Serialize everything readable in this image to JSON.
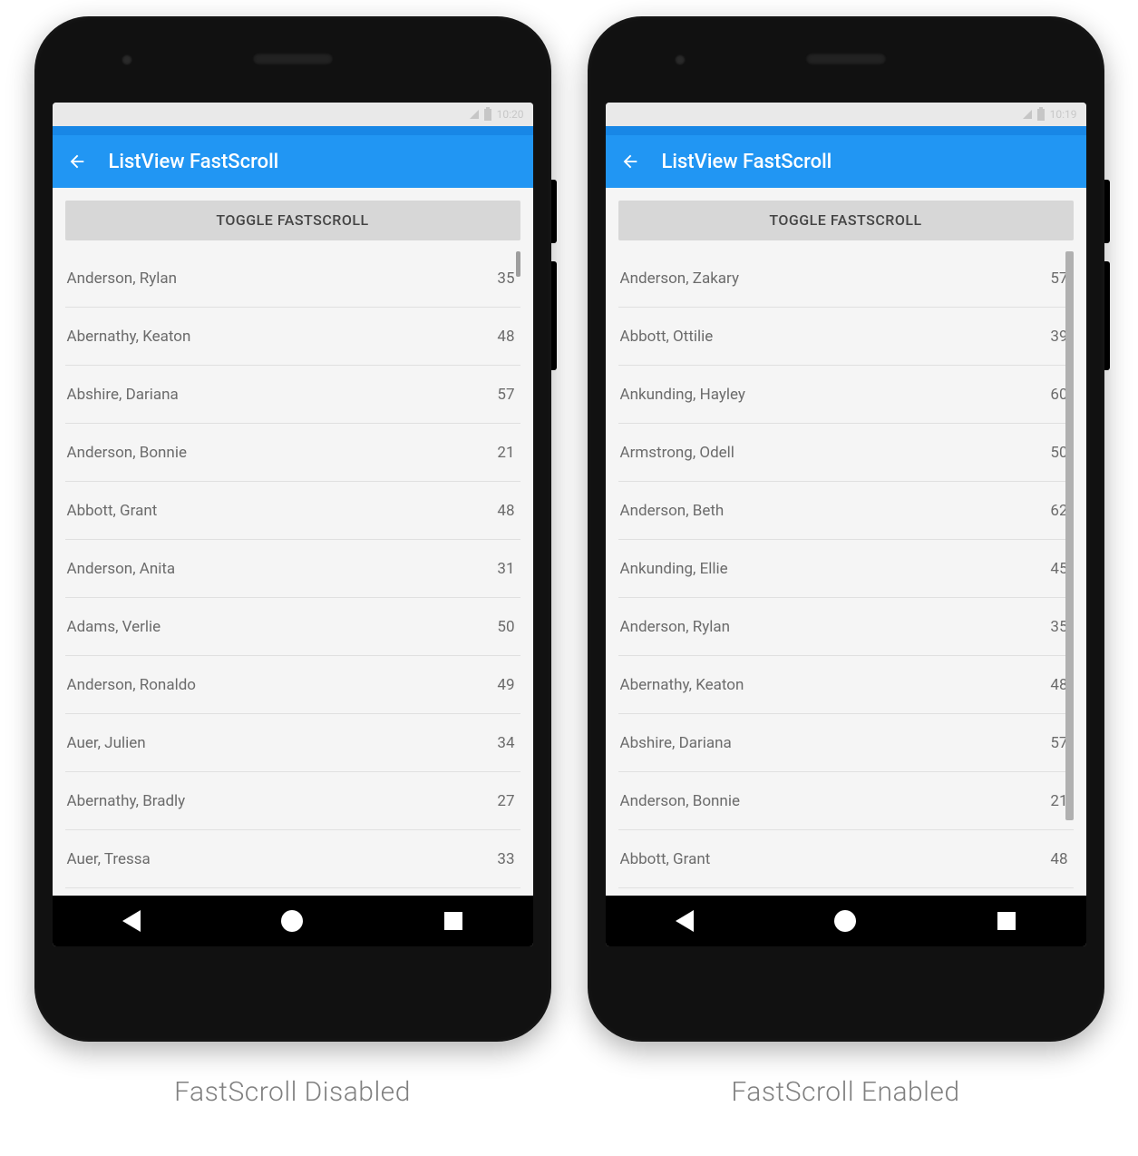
{
  "colors": {
    "primary": "#2196f3",
    "primary_dark": "#1887e6"
  },
  "statusbar": {
    "time_left": "10:20",
    "time_right": "10:19"
  },
  "appbar": {
    "title": "ListView FastScroll"
  },
  "toggle_label": "TOGGLE FASTSCROLL",
  "left": {
    "caption": "FastScroll Disabled",
    "rows": [
      {
        "name": "Anderson, Rylan",
        "value": "35"
      },
      {
        "name": "Abernathy, Keaton",
        "value": "48"
      },
      {
        "name": "Abshire, Dariana",
        "value": "57"
      },
      {
        "name": "Anderson, Bonnie",
        "value": "21"
      },
      {
        "name": "Abbott, Grant",
        "value": "48"
      },
      {
        "name": "Anderson, Anita",
        "value": "31"
      },
      {
        "name": "Adams, Verlie",
        "value": "50"
      },
      {
        "name": "Anderson, Ronaldo",
        "value": "49"
      },
      {
        "name": "Auer, Julien",
        "value": "34"
      },
      {
        "name": "Abernathy, Bradly",
        "value": "27"
      },
      {
        "name": "Auer, Tressa",
        "value": "33"
      }
    ]
  },
  "right": {
    "caption": "FastScroll Enabled",
    "rows": [
      {
        "name": "Anderson, Zakary",
        "value": "57"
      },
      {
        "name": "Abbott, Ottilie",
        "value": "39"
      },
      {
        "name": "Ankunding, Hayley",
        "value": "60"
      },
      {
        "name": "Armstrong, Odell",
        "value": "50"
      },
      {
        "name": "Anderson, Beth",
        "value": "62"
      },
      {
        "name": "Ankunding, Ellie",
        "value": "45"
      },
      {
        "name": "Anderson, Rylan",
        "value": "35"
      },
      {
        "name": "Abernathy, Keaton",
        "value": "48"
      },
      {
        "name": "Abshire, Dariana",
        "value": "57"
      },
      {
        "name": "Anderson, Bonnie",
        "value": "21"
      },
      {
        "name": "Abbott, Grant",
        "value": "48"
      }
    ]
  }
}
